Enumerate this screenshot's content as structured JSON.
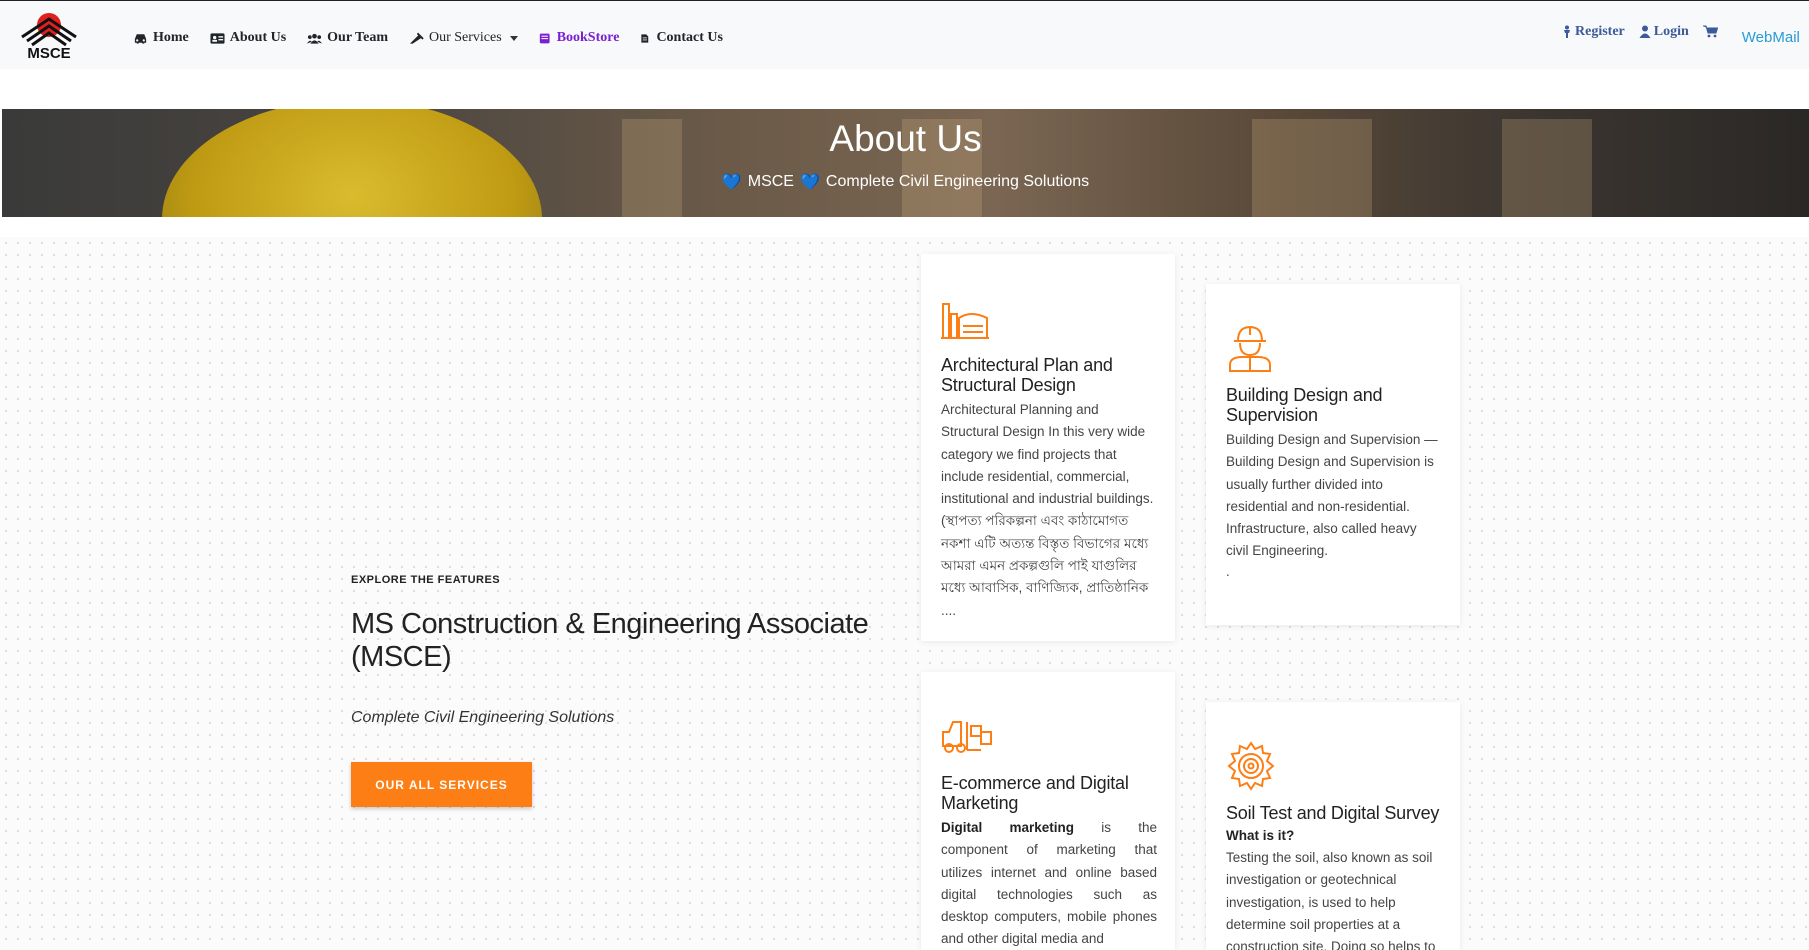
{
  "nav": {
    "logo_text": "MSCE",
    "items": [
      {
        "label": "Home",
        "icon": "car-icon"
      },
      {
        "label": "About Us",
        "icon": "id-card-icon"
      },
      {
        "label": "Our Team",
        "icon": "users-icon"
      },
      {
        "label": "Our Services",
        "icon": "tools-icon"
      },
      {
        "label": "BookStore",
        "icon": "book-icon"
      },
      {
        "label": "Contact Us",
        "icon": "file-icon"
      }
    ],
    "right": {
      "register": "Register",
      "login": "Login",
      "webmail": "WebMail"
    }
  },
  "hero": {
    "title": "About Us",
    "brand": "MSCE",
    "subtitle": "Complete Civil Engineering Solutions"
  },
  "intro": {
    "eyebrow": "EXPLORE THE FEATURES",
    "title": "MS Construction & Engineering Associate (MSCE)",
    "tagline": "Complete Civil Engineering Solutions",
    "button": "OUR ALL SERVICES"
  },
  "cards": [
    {
      "title": "Architectural Plan and Structural Design",
      "body": "Architectural Planning and Structural Design In this very wide category we find projects that include residential, commercial, institutional and industrial buildings. (স্থাপত্য পরিকল্পনা এবং কাঠামোগত নকশা এটি অত্যন্ত বিস্তৃত বিভাগের মধ্যে আমরা এমন প্রকল্পগুলি পাই যাগুলির মধ্যে আবাসিক, বাণিজ্যিক, প্রাতিষ্ঠানিক ...."
    },
    {
      "title": "Building Design and Supervision",
      "body": "Building Design and Supervision — Building Design and Supervision is usually further divided into residential and non-residential. Infrastructure, also called heavy civil Engineering.",
      "extra": "."
    },
    {
      "title": "E-commerce and Digital Marketing",
      "body_bold": "Digital marketing",
      "body": " is the component of marketing that utilizes internet and online based digital technologies such as desktop computers, mobile phones and other digital media and"
    },
    {
      "title": "Soil Test and Digital Survey",
      "subheading": "What is it?",
      "body": "Testing the soil, also known as soil investigation or geotechnical investigation, is used to help determine soil properties at a construction site. Doing so helps to"
    }
  ],
  "colors": {
    "accent": "#fd7e14",
    "bookstore": "#7a1fd1",
    "nav_right": "#3c5a9a",
    "webmail": "#2a9bd6"
  }
}
